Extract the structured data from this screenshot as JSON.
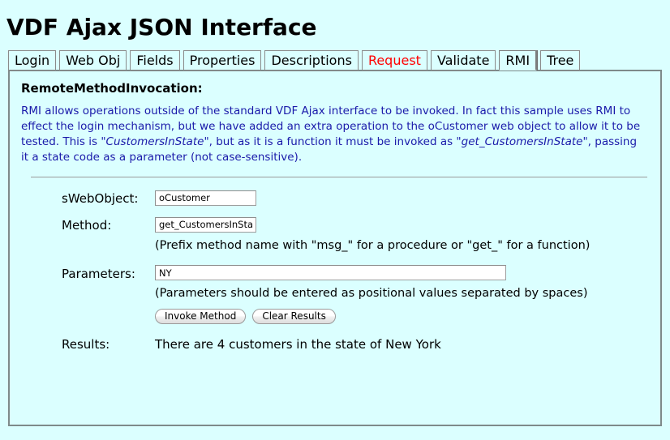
{
  "page": {
    "title": "VDF Ajax JSON Interface",
    "background_color": "#dbffff"
  },
  "tabs": [
    {
      "label": "Login",
      "active": false,
      "color": "#000000"
    },
    {
      "label": "Web Obj",
      "active": false,
      "color": "#000000"
    },
    {
      "label": "Fields",
      "active": false,
      "color": "#000000"
    },
    {
      "label": "Properties",
      "active": false,
      "color": "#000000"
    },
    {
      "label": "Descriptions",
      "active": false,
      "color": "#000000"
    },
    {
      "label": "Request",
      "active": false,
      "color": "#ff0000"
    },
    {
      "label": "Validate",
      "active": false,
      "color": "#000000"
    },
    {
      "label": "RMI",
      "active": true,
      "color": "#000000"
    },
    {
      "label": "Tree",
      "active": false,
      "color": "#000000"
    }
  ],
  "panel": {
    "heading": "RemoteMethodInvocation:",
    "description_part1": "RMI allows operations outside of the standard VDF Ajax interface to be invoked. In fact this sample uses RMI to effect the login mechanism, but we have added an extra operation to the oCustomer web object to allow it to be tested. This is \"",
    "description_em1": "CustomersInState",
    "description_part2": "\", but as it is a function it must be invoked as \"",
    "description_em2": "get_CustomersInState",
    "description_part3": "\", passing it a state code as a parameter (not case-sensitive).",
    "text_color": "#1a1aaa"
  },
  "form": {
    "webobject_label": "sWebObject:",
    "webobject_value": "oCustomer",
    "webobject_placeholder": "",
    "method_label": "Method:",
    "method_value": "get_CustomersInState",
    "method_placeholder": "",
    "method_hint": "(Prefix method name with \"msg_\" for a procedure or \"get_\" for a function)",
    "parameters_label": "Parameters:",
    "parameters_value": "NY",
    "parameters_placeholder": "",
    "parameters_hint": "(Parameters should be entered as positional values separated by spaces)",
    "invoke_button": "Invoke Method",
    "clear_button": "Clear Results",
    "results_label": "Results:",
    "results_value": "There are 4 customers in the state of New York"
  }
}
